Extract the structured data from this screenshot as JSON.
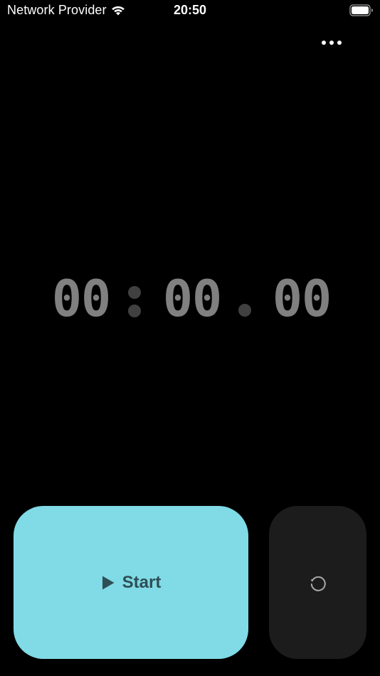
{
  "status_bar": {
    "carrier": "Network Provider",
    "time": "20:50",
    "wifi_icon": "wifi-icon",
    "battery_icon": "battery-full-icon"
  },
  "toolbar": {
    "more_icon": "ellipsis-icon"
  },
  "timer": {
    "minutes": "00",
    "seconds": "00",
    "centiseconds": "00",
    "digit_color": "#808080",
    "separator_color": "#404040"
  },
  "controls": {
    "start_label": "Start",
    "start_icon": "play-icon",
    "start_bg": "#80dbe6",
    "start_fg": "#2e4f55",
    "reset_icon": "reset-icon",
    "reset_bg": "#1c1c1c"
  }
}
